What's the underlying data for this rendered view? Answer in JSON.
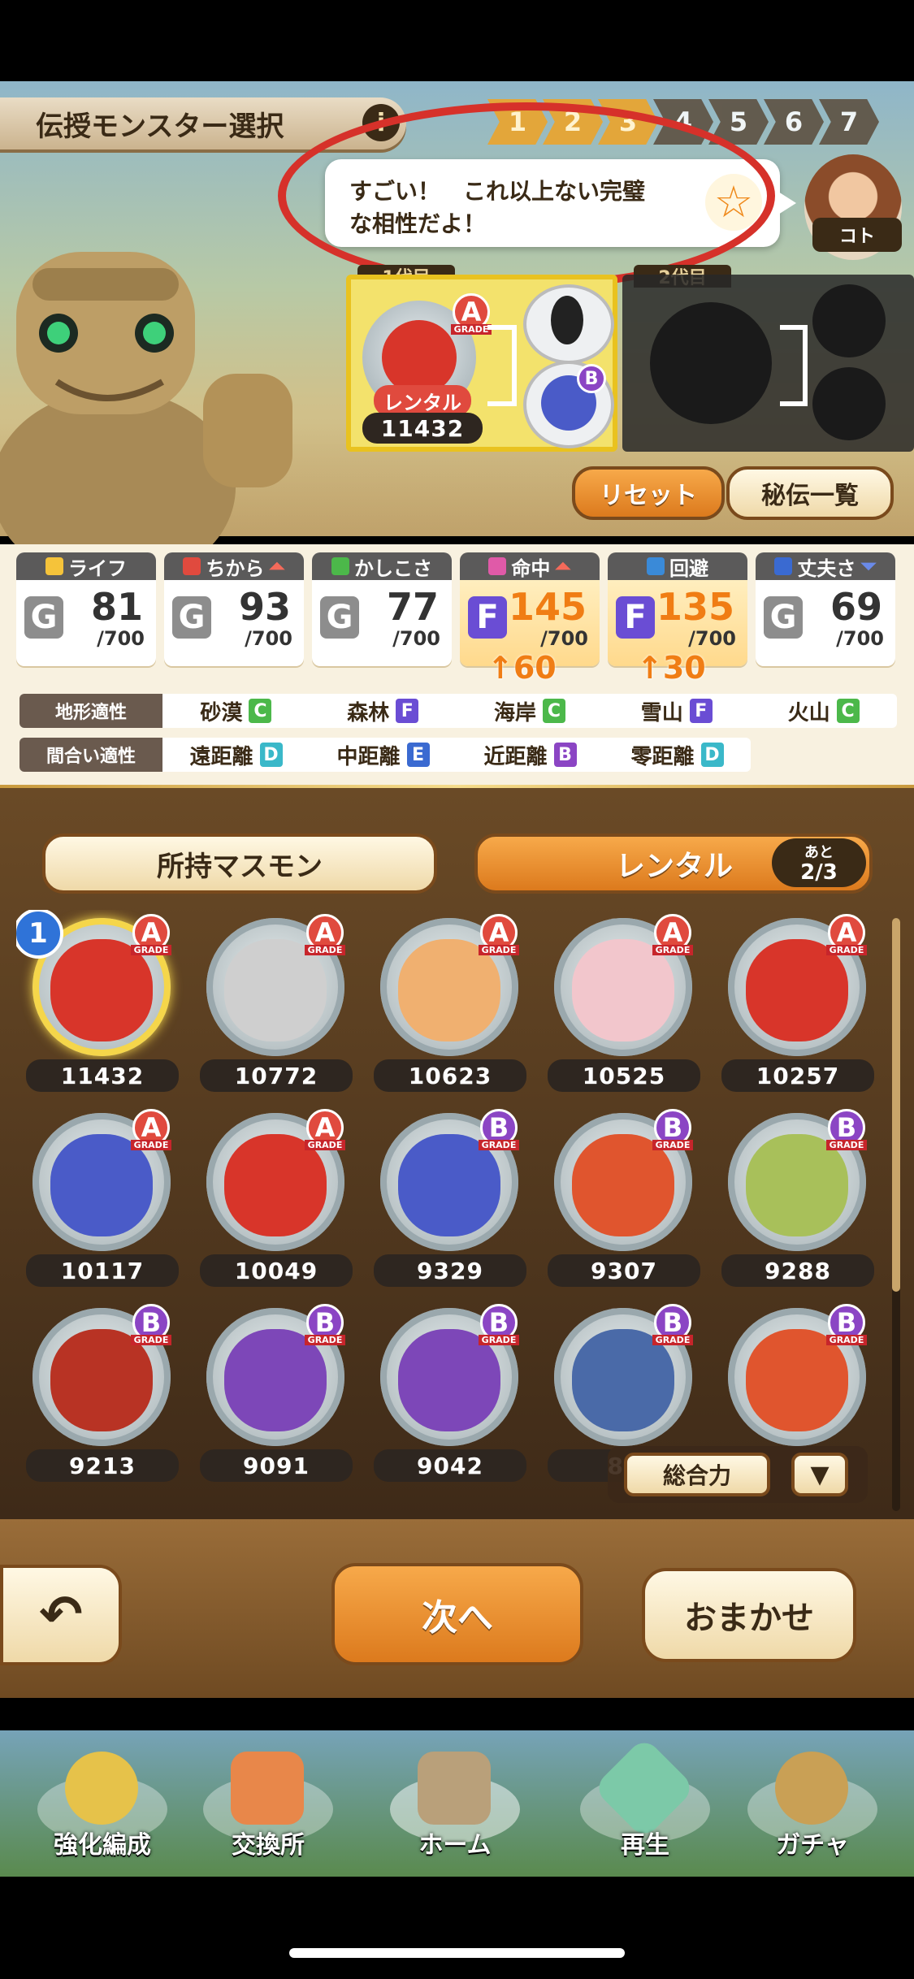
{
  "header": {
    "title": "伝授モンスター選択",
    "steps": [
      "1",
      "2",
      "3",
      "4",
      "5",
      "6",
      "7"
    ]
  },
  "bubble": {
    "line1": "すごい！　これ以上ない完璧",
    "line2": "な相性だよ！"
  },
  "advisor": {
    "tag": "コト"
  },
  "pedigree": {
    "label1": "1代目",
    "label2": "2代目",
    "main_grade": "A",
    "rental_label": "レンタル",
    "main_number": "11432",
    "parent_grade": "B"
  },
  "actions": {
    "reset": "リセット",
    "secret_list": "秘伝一覧"
  },
  "stats": [
    {
      "name": "ライフ",
      "rank": "G",
      "value": "81",
      "max": "/700"
    },
    {
      "name": "ちから",
      "rank": "G",
      "value": "93",
      "max": "/700"
    },
    {
      "name": "かしこさ",
      "rank": "G",
      "value": "77",
      "max": "/700"
    },
    {
      "name": "命中",
      "rank": "F",
      "value": "145",
      "max": "/700",
      "boost": "↑60"
    },
    {
      "name": "回避",
      "rank": "F",
      "value": "135",
      "max": "/700",
      "boost": "↑30"
    },
    {
      "name": "丈夫さ",
      "rank": "G",
      "value": "69",
      "max": "/700"
    }
  ],
  "terrain": {
    "label": "地形適性",
    "items": [
      {
        "name": "砂漠",
        "grade": "C"
      },
      {
        "name": "森林",
        "grade": "F"
      },
      {
        "name": "海岸",
        "grade": "C"
      },
      {
        "name": "雪山",
        "grade": "F"
      },
      {
        "name": "火山",
        "grade": "C"
      }
    ]
  },
  "distance": {
    "label": "間合い適性",
    "items": [
      {
        "name": "遠距離",
        "grade": "D"
      },
      {
        "name": "中距離",
        "grade": "E"
      },
      {
        "name": "近距離",
        "grade": "B"
      },
      {
        "name": "零距離",
        "grade": "D"
      }
    ]
  },
  "tabs": {
    "owned": "所持マスモン",
    "rental": "レンタル",
    "remaining_label": "あと",
    "remaining": "2/3"
  },
  "monsters": [
    {
      "n": "11432",
      "g": "A",
      "c": "#d8352a",
      "sel": "1"
    },
    {
      "n": "10772",
      "g": "A",
      "c": "#cfcfcf"
    },
    {
      "n": "10623",
      "g": "A",
      "c": "#f0b070"
    },
    {
      "n": "10525",
      "g": "A",
      "c": "#f2c6cc"
    },
    {
      "n": "10257",
      "g": "A",
      "c": "#d8352a"
    },
    {
      "n": "10117",
      "g": "A",
      "c": "#4a5bc8"
    },
    {
      "n": "10049",
      "g": "A",
      "c": "#d8352a"
    },
    {
      "n": "9329",
      "g": "B",
      "c": "#4a5bc8"
    },
    {
      "n": "9307",
      "g": "B",
      "c": "#e0552e"
    },
    {
      "n": "9288",
      "g": "B",
      "c": "#a8c05a"
    },
    {
      "n": "9213",
      "g": "B",
      "c": "#b83324"
    },
    {
      "n": "9091",
      "g": "B",
      "c": "#7d47b8"
    },
    {
      "n": "9042",
      "g": "B",
      "c": "#7d47b8"
    },
    {
      "n": "88",
      "g": "B",
      "c": "#4a6aa8"
    },
    {
      "n": "",
      "g": "B",
      "c": "#e0552e"
    }
  ],
  "sort": {
    "label": "総合力",
    "arrow": "▼"
  },
  "footer": {
    "back": "↶",
    "next": "次へ",
    "auto": "おまかせ"
  },
  "nav": [
    {
      "label": "強化編成",
      "color": "#e6c24a"
    },
    {
      "label": "交換所",
      "color": "#e8874a"
    },
    {
      "label": "ホーム",
      "color": "#b9a07a"
    },
    {
      "label": "再生",
      "color": "#7cc9a8"
    },
    {
      "label": "ガチャ",
      "color": "#c9a055"
    }
  ],
  "colors": {
    "gradeA": "#e04a3e",
    "gradeB": "#8b45c4",
    "gradeC": "#4cb84a",
    "gradeD": "#3ab8c9",
    "gradeE": "#3a6ad1",
    "gradeF": "#6a4dd4"
  }
}
